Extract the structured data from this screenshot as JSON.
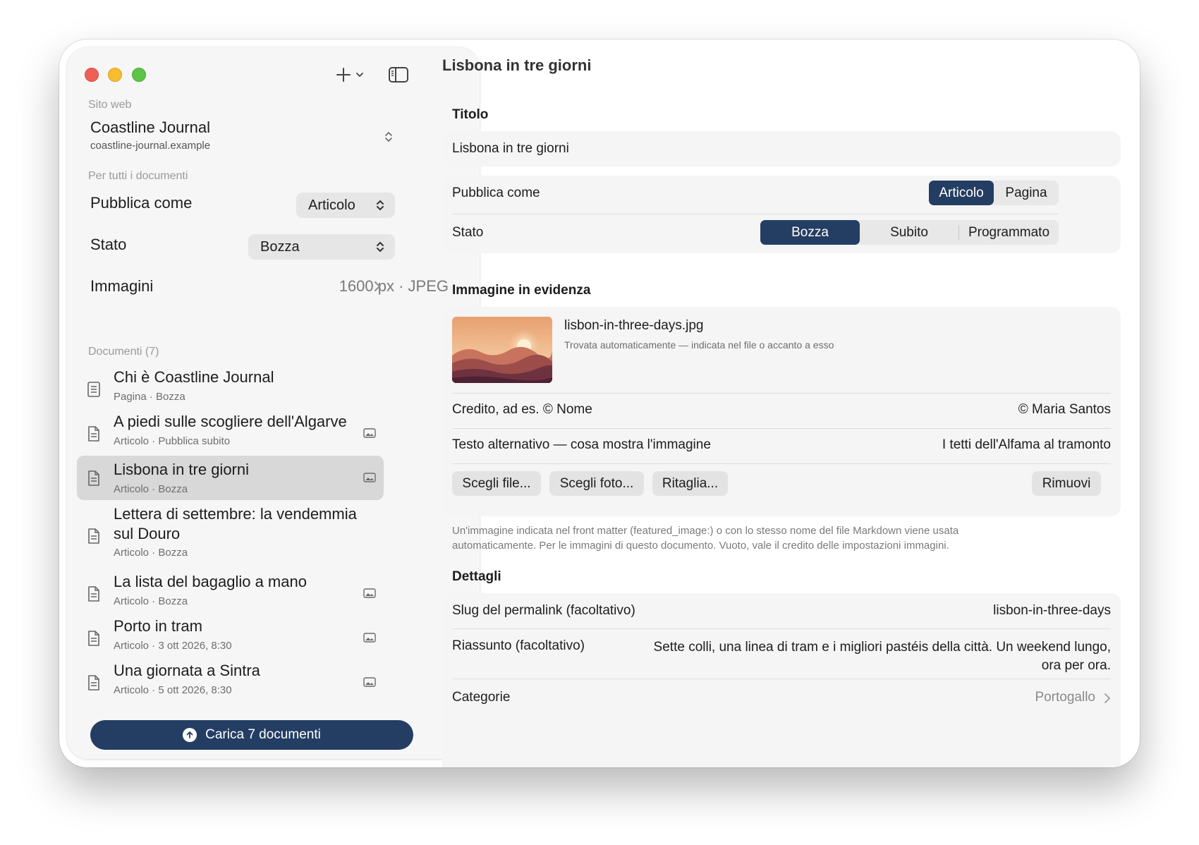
{
  "sidebar": {
    "website_label": "Sito web",
    "site_name": "Coastline Journal",
    "site_url": "coastline-journal.example",
    "all_docs_label": "Per tutti i documenti",
    "publish_as_label": "Pubblica come",
    "publish_as_value": "Articolo",
    "status_label": "Stato",
    "status_value": "Bozza",
    "images_label": "Immagini",
    "images_value": "1600 px · JPEG",
    "documents_label": "Documenti (7)",
    "documents": [
      {
        "title": "Chi è Coastline Journal",
        "meta": "Pagina · Bozza",
        "has_image": false,
        "selected": false
      },
      {
        "title": "A piedi sulle scogliere dell'Algarve",
        "meta": "Articolo · Pubblica subito",
        "has_image": true,
        "selected": false
      },
      {
        "title": "Lisbona in tre giorni",
        "meta": "Articolo · Bozza",
        "has_image": true,
        "selected": true
      },
      {
        "title_line1": "Lettera di settembre: la vendemmia",
        "title_line2": "sul Douro",
        "meta": "Articolo · Bozza",
        "has_image": false,
        "selected": false
      },
      {
        "title": "La lista del bagaglio a mano",
        "meta": "Articolo · Bozza",
        "has_image": true,
        "selected": false
      },
      {
        "title": "Porto in tram",
        "meta": "Articolo · 3 ott 2026, 8:30",
        "has_image": true,
        "selected": false
      },
      {
        "title": "Una giornata a Sintra",
        "meta": "Articolo · 5 ott 2026, 8:30",
        "has_image": true,
        "selected": false
      }
    ],
    "upload_label": "Carica 7 documenti"
  },
  "main": {
    "window_title": "Lisbona in tre giorni",
    "title_section": "Titolo",
    "title_value": "Lisbona in tre giorni",
    "publish_as_label": "Pubblica come",
    "publish_as_options": [
      "Articolo",
      "Pagina"
    ],
    "publish_as_selected": "Articolo",
    "status_label": "Stato",
    "status_options": [
      "Bozza",
      "Subito",
      "Programmato"
    ],
    "status_selected": "Bozza",
    "featured_section": "Immagine in evidenza",
    "image_filename": "lisbon-in-three-days.jpg",
    "image_note": "Trovata automaticamente — indicata nel file o accanto a esso",
    "credit_label": "Credito, ad es. © Nome",
    "credit_value": "© Maria Santos",
    "alt_label": "Testo alternativo — cosa mostra l'immagine",
    "alt_value": "I tetti dell'Alfama al tramonto",
    "buttons": {
      "choose_file": "Scegli file...",
      "choose_photo": "Scegli foto...",
      "crop": "Ritaglia...",
      "remove": "Rimuovi"
    },
    "helper_line1": "Un'immagine indicata nel front matter (featured_image:) o con lo stesso nome del file Markdown viene usata",
    "helper_line2": "automaticamente. Per le immagini di questo documento. Vuoto, vale il credito delle impostazioni immagini.",
    "details_section": "Dettagli",
    "slug_label": "Slug del permalink (facoltativo)",
    "slug_value": "lisbon-in-three-days",
    "summary_label": "Riassunto (facoltativo)",
    "summary_line1": "Sette colli, una linea di tram e i migliori pastéis della città. Un weekend lungo,",
    "summary_line2": "ora per ora.",
    "categories_label": "Categorie",
    "categories_value": "Portogallo"
  },
  "colors": {
    "accent": "#243e63",
    "close": "#ee5f57",
    "minimize": "#f5bd2f",
    "zoom": "#5cc447"
  }
}
